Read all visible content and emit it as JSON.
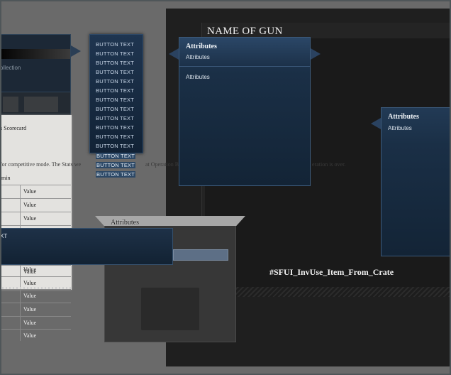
{
  "gun_panel": {
    "title": "NAME OF GUN",
    "crate_label": "#SFUI_InvUse_Item_From_Crate"
  },
  "left_window": {
    "label": "ollection"
  },
  "scorecard": {
    "title": "s Scorecard",
    "note": "for competitive mode.  The Stats we",
    "note_tail": "at Operation B",
    "note_end": "eration is over.",
    "min_label": "min",
    "rows": [
      "Value",
      "Value",
      "Value",
      "Value",
      "Value",
      "Value",
      "Value",
      "Value",
      "Value",
      "Value",
      "Value"
    ]
  },
  "wide_tooltip": {
    "label": "XT"
  },
  "dialog": {
    "title": "Attributes"
  },
  "button_list": {
    "items": [
      "BUTTON TEXT",
      "BUTTON TEXT",
      "BUTTON TEXT",
      "BUTTON TEXT",
      "BUTTON TEXT",
      "BUTTON TEXT",
      "BUTTON TEXT",
      "BUTTON TEXT",
      "BUTTON TEXT",
      "BUTTON TEXT",
      "BUTTON TEXT",
      "BUTTON TEXT",
      "BUTTON TEXT",
      "BUTTON TEXT",
      "BUTTON TEXT"
    ]
  },
  "tooltip_main": {
    "title": "Attributes",
    "subtitle": "Attributes",
    "body": "Attributes"
  },
  "tooltip_right": {
    "title": "Attributes",
    "subtitle": "Attributes"
  }
}
